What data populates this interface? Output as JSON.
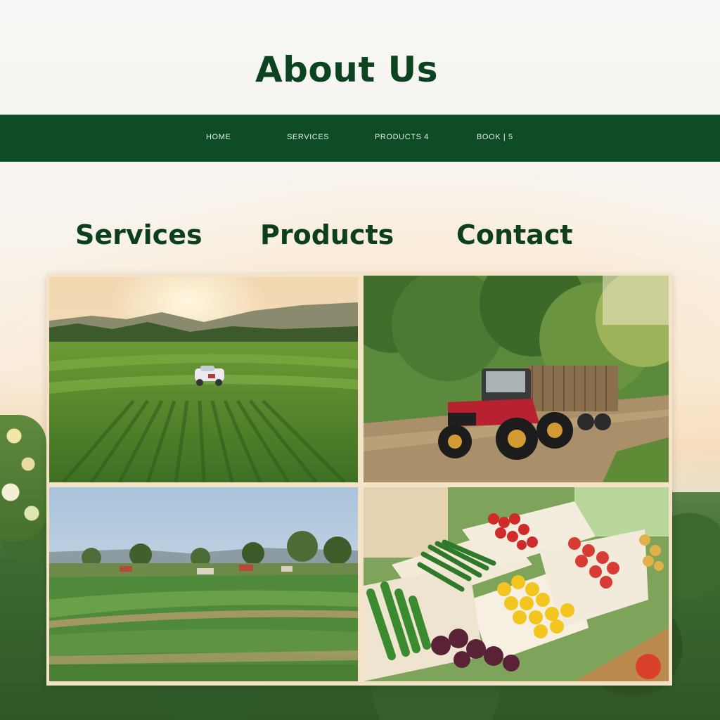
{
  "page": {
    "title": "About Us"
  },
  "navbar": {
    "items": [
      {
        "label": "HOME"
      },
      {
        "label": "SERVICES"
      },
      {
        "label": "PRODUCTS 4"
      },
      {
        "label": "BOOK | 5"
      }
    ]
  },
  "sections": {
    "services_label": "Services",
    "products_label": "Products",
    "contact_label": "Contact"
  },
  "gallery": {
    "images": [
      {
        "subject": "farm-field-with-harvester-at-sunset"
      },
      {
        "subject": "red-tractor-with-trailer-on-dirt-road"
      },
      {
        "subject": "green-fields-with-village"
      },
      {
        "subject": "boxed-fresh-vegetables-and-fruits"
      }
    ]
  },
  "colors": {
    "brand_green": "#0e4c27",
    "title_green": "#0c4320",
    "nav_text": "#e6efe8"
  }
}
